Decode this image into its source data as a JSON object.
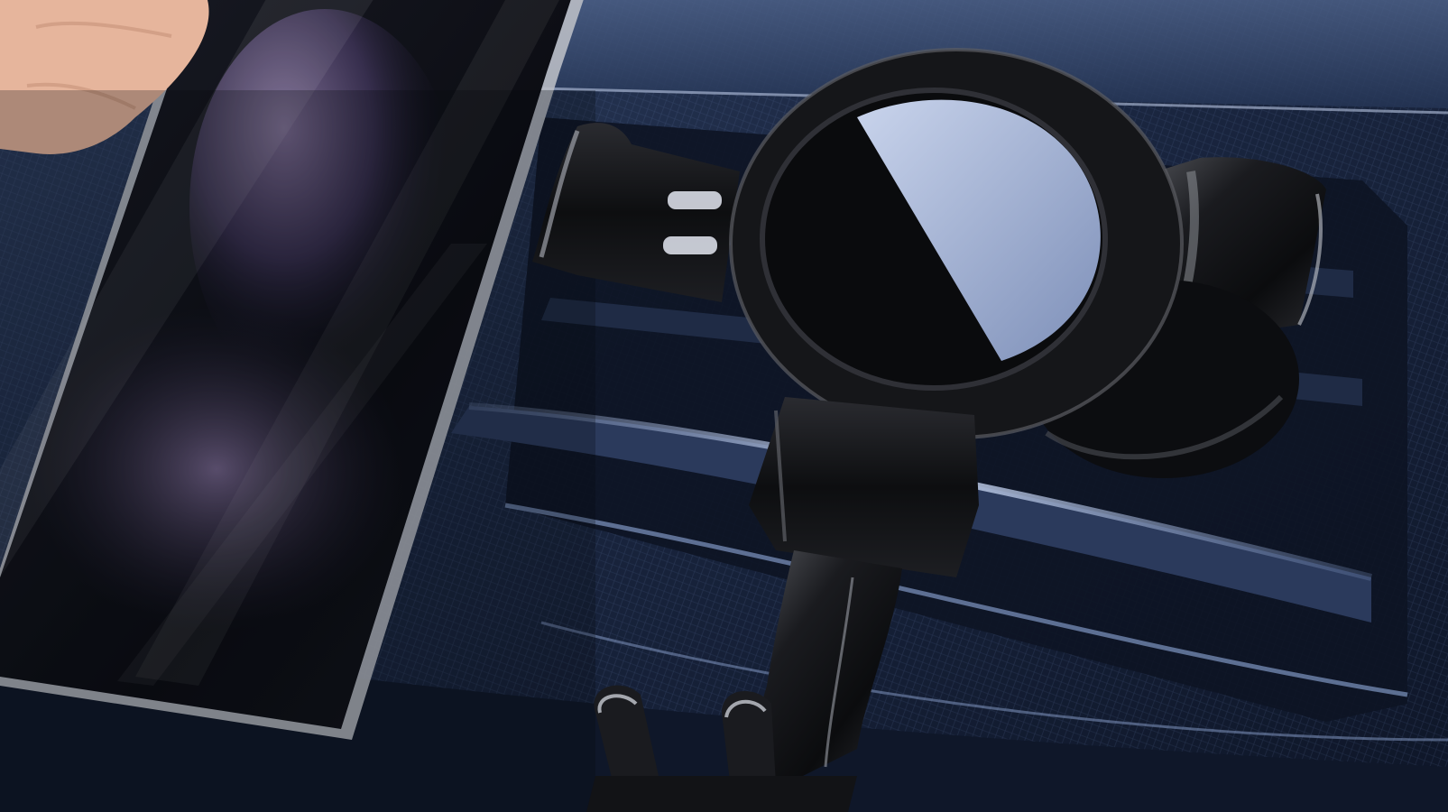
{
  "scene": {
    "subject": "car-air-vent-phone-holder",
    "colors": {
      "dashboard": "#1b2740",
      "dashboard_light": "#3f5376",
      "vent_shadow": "#0a0f19",
      "holder_body": "#111215",
      "holder_highlight": "#8f9196",
      "lens_blue": "#a9b8d8",
      "phone_glass": "#0d0f16",
      "skin": "#e7b9a0"
    }
  }
}
